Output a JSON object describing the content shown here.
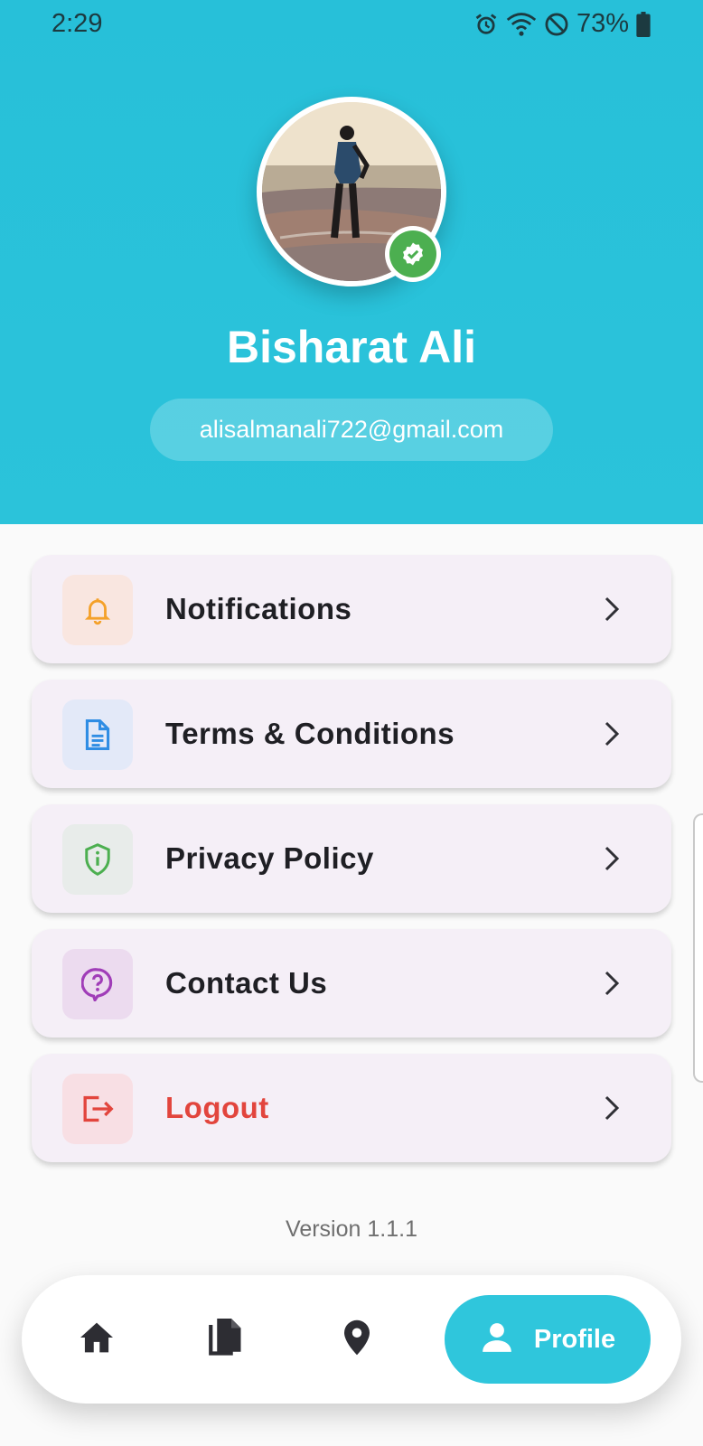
{
  "status_bar": {
    "time": "2:29",
    "battery": "73%",
    "icons": [
      "alarm-icon",
      "wifi-icon",
      "do-not-disturb-icon",
      "battery-icon"
    ]
  },
  "profile": {
    "name": "Bisharat Ali",
    "email": "alisalmanali722@gmail.com",
    "verified": true
  },
  "menu": {
    "items": [
      {
        "label": "Notifications",
        "icon": "bell-icon",
        "color": "#f4a12a",
        "tint": "#f9e6e0"
      },
      {
        "label": "Terms & Conditions",
        "icon": "document-icon",
        "color": "#2f8de4",
        "tint": "#e3e9f8"
      },
      {
        "label": "Privacy Policy",
        "icon": "shield-info-icon",
        "color": "#4caf50",
        "tint": "#e8ecea"
      },
      {
        "label": "Contact Us",
        "icon": "help-chat-icon",
        "color": "#a03db8",
        "tint": "#ecdbef"
      },
      {
        "label": "Logout",
        "icon": "logout-icon",
        "color": "#e2453d",
        "tint": "#f8dfe4"
      }
    ]
  },
  "version": "Version 1.1.1",
  "bottom_nav": {
    "items": [
      "home-icon",
      "documents-icon",
      "location-icon"
    ],
    "active_label": "Profile",
    "accent": "#2fc6dc"
  },
  "colors": {
    "header": "#27c0d9",
    "card_bg": "#f5eff7",
    "danger": "#e2453d"
  }
}
